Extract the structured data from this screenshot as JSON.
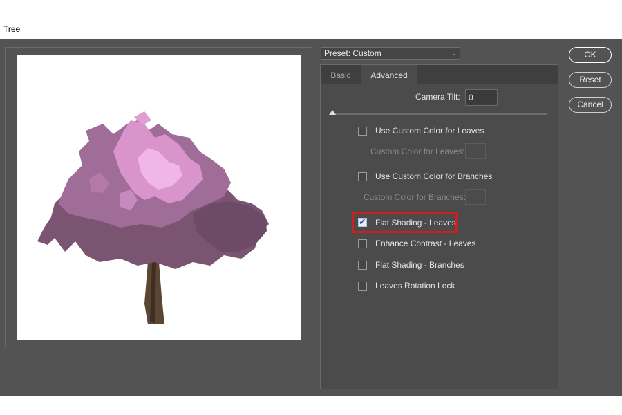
{
  "window": {
    "title": "Tree"
  },
  "preset": {
    "label": "Preset: Custom"
  },
  "tabs": [
    {
      "label": "Basic"
    },
    {
      "label": "Advanced"
    }
  ],
  "advanced": {
    "camera_tilt_label": "Camera Tilt:",
    "camera_tilt_value": "0",
    "use_custom_leaves_label": "Use Custom Color for Leaves",
    "custom_leaves_color_label": "Custom Color for Leaves:",
    "use_custom_branches_label": "Use Custom Color for Branches",
    "custom_branches_color_label": "Custom Color for Branches:",
    "flat_shading_leaves_label": "Flat Shading - Leaves",
    "flat_shading_leaves_checked": true,
    "enhance_contrast_leaves_label": "Enhance Contrast - Leaves",
    "flat_shading_branches_label": "Flat Shading - Branches",
    "leaves_rotation_lock_label": "Leaves Rotation Lock"
  },
  "buttons": {
    "ok": "OK",
    "reset": "Reset",
    "cancel": "Cancel"
  },
  "colors": {
    "dialog_bg": "#535353",
    "highlight": "#cc1f1f",
    "leaves_dark": "#7a5470",
    "leaves_mid": "#a06c98",
    "leaves_light": "#e8a9dc",
    "trunk": "#5a4632"
  }
}
